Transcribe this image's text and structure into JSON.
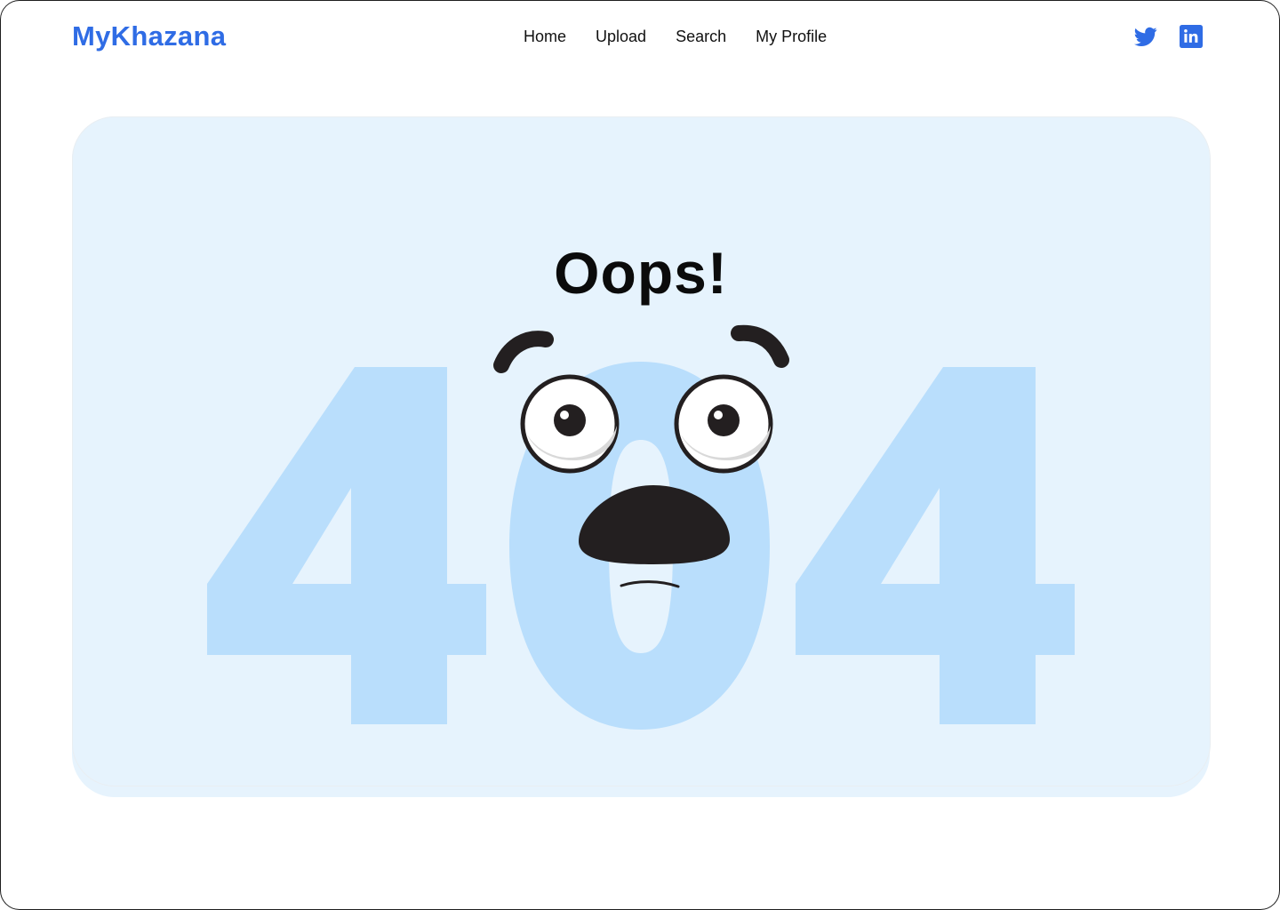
{
  "brand": {
    "name": "MyKhazana",
    "color": "#2f6ce5"
  },
  "nav": {
    "items": [
      {
        "label": "Home"
      },
      {
        "label": "Upload"
      },
      {
        "label": "Search"
      },
      {
        "label": "My Profile"
      }
    ]
  },
  "social": {
    "icons": [
      "twitter-icon",
      "linkedin-icon"
    ],
    "color": "#2f6ce5"
  },
  "error": {
    "heading": "Oops!",
    "code": "404",
    "card_color": "#e6f3fd",
    "digit_color": "#b9defc"
  }
}
